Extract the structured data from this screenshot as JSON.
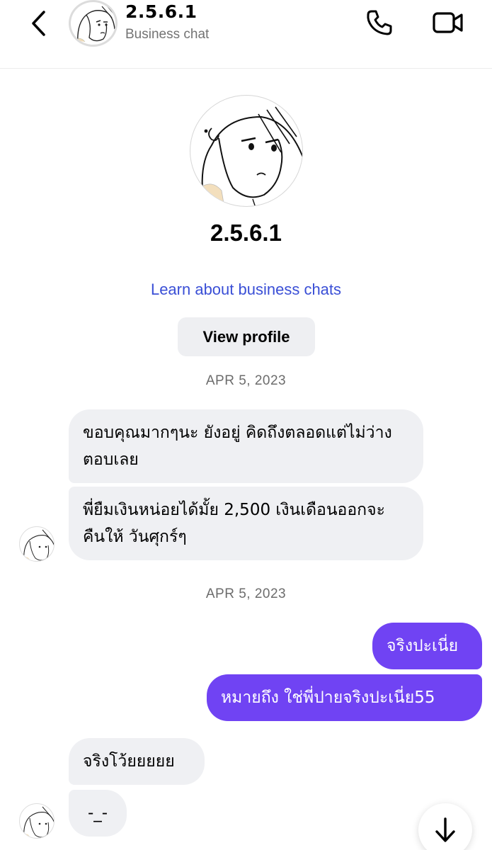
{
  "header": {
    "name": "2.5.6.1",
    "subtitle": "Business chat"
  },
  "profile": {
    "name": "2.5.6.1",
    "learn_link": "Learn about business chats",
    "view_profile_label": "View profile"
  },
  "dates": [
    "APR 5, 2023",
    "APR 5, 2023"
  ],
  "messages": [
    {
      "from": "them",
      "text": "ขอบคุณมากๆนะ ยังอยู่ คิดถึงตลอดแต่ไม่ว่างตอบเลย"
    },
    {
      "from": "them",
      "text": "พี่ยืมเงินหน่อยได้มั้ย 2,500 เงินเดือนออกจะคืนให้ วันศุกร์ๆ"
    },
    {
      "from": "me",
      "text": "จริงปะเนี่ย"
    },
    {
      "from": "me",
      "text": "หมายถึง ใช่พี่ปายจริงปะเนี่ย55"
    },
    {
      "from": "them",
      "text": "จริงโว้ยยยยย"
    },
    {
      "from": "them",
      "text": "-_-"
    }
  ],
  "colors": {
    "accent": "#7043f3",
    "incoming_bubble": "#eff0f3",
    "link": "#3a4fd6"
  },
  "icons": [
    "back-arrow-icon",
    "phone-icon",
    "video-camera-icon",
    "arrow-down-icon"
  ]
}
